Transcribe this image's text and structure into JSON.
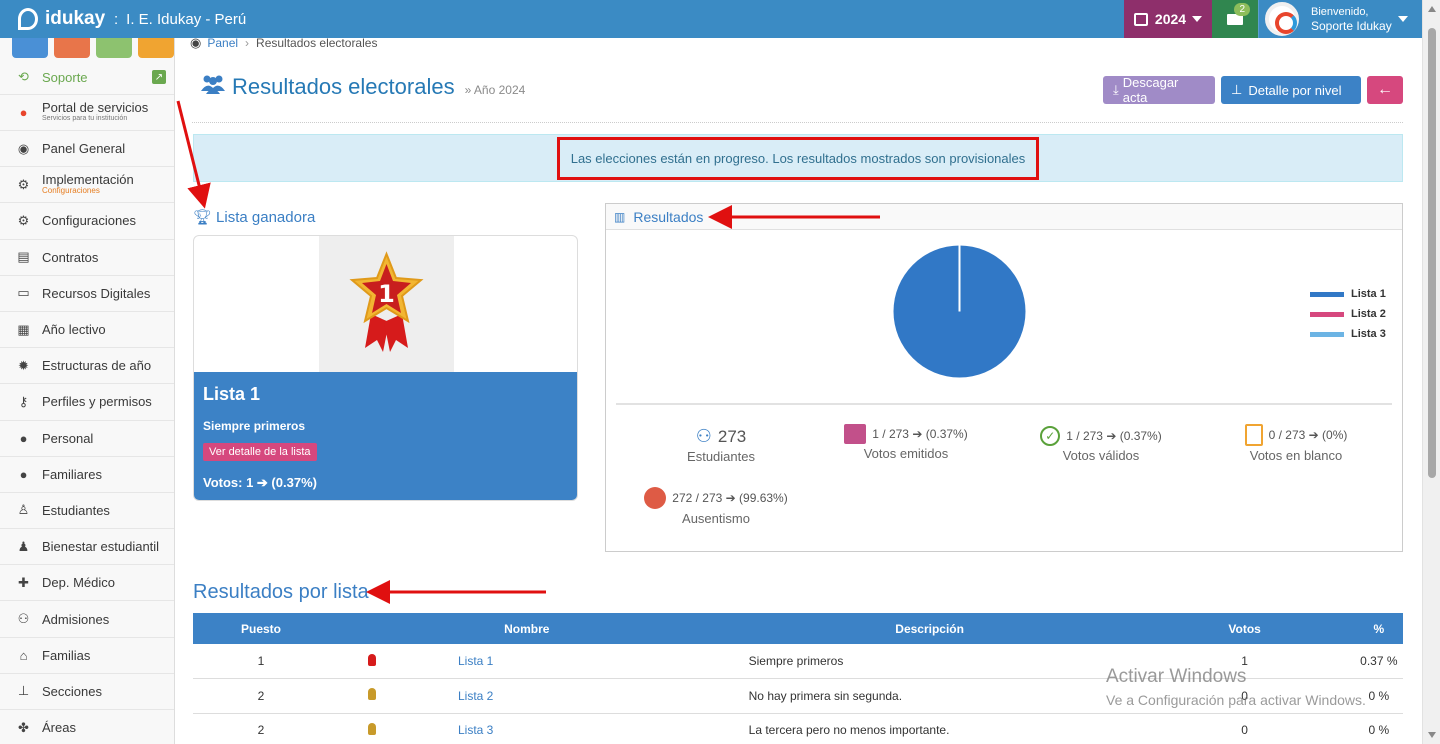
{
  "app": {
    "logo_text": "idukay",
    "institution": "I. E. Idukay - Perú",
    "year": "2024",
    "mail_badge": "2",
    "welcome": "Bienvenido,",
    "user_name": "Soporte Idukay"
  },
  "sidebar": {
    "soporte": "Soporte",
    "portal": {
      "label": "Portal de servicios",
      "sub": "Servicios para tu institución"
    },
    "items": [
      {
        "label": "Panel General",
        "icon": "dashboard-icon"
      },
      {
        "label": "Implementación",
        "sub": "Configuraciones",
        "icon": "gears-icon"
      },
      {
        "label": "Configuraciones",
        "icon": "gears-icon"
      },
      {
        "label": "Contratos",
        "icon": "document-icon"
      },
      {
        "label": "Recursos Digitales",
        "icon": "laptop-icon"
      },
      {
        "label": "Año lectivo",
        "icon": "calendar-icon"
      },
      {
        "label": "Estructuras de año",
        "icon": "gear-icon"
      },
      {
        "label": "Perfiles y permisos",
        "icon": "key-icon"
      },
      {
        "label": "Personal",
        "icon": "user-icon"
      },
      {
        "label": "Familiares",
        "icon": "user-icon"
      },
      {
        "label": "Estudiantes",
        "icon": "student-icon"
      },
      {
        "label": "Bienestar estudiantil",
        "icon": "wellbeing-icon"
      },
      {
        "label": "Dep. Médico",
        "icon": "medkit-icon"
      },
      {
        "label": "Admisiones",
        "icon": "users-icon"
      },
      {
        "label": "Familias",
        "icon": "home-icon"
      },
      {
        "label": "Secciones",
        "icon": "sitemap-icon"
      },
      {
        "label": "Áreas",
        "icon": "puzzle-icon"
      }
    ]
  },
  "breadcrumb": {
    "panel": "Panel",
    "current": "Resultados electorales"
  },
  "header": {
    "title": "Resultados electorales",
    "subtitle": "» Año 2024",
    "download_label": "Descagar acta",
    "detail_label": "Detalle por nivel"
  },
  "alert": "Las elecciones están en progreso. Los resultados mostrados son provisionales",
  "winner": {
    "section_title": "Lista ganadora",
    "name": "Lista 1",
    "motto": "Siempre primeros",
    "detail_button": "Ver detalle de la lista",
    "votes": "Votos: 1 ➔ (0.37%)"
  },
  "results": {
    "title": "Resultados",
    "students_count": "273",
    "students_label": "Estudiantes",
    "emitted": "1 / 273 ➔ (0.37%)",
    "emitted_label": "Votos emitidos",
    "valid": "1 / 273 ➔ (0.37%)",
    "valid_label": "Votos válidos",
    "blank": "0 / 273 ➔ (0%)",
    "blank_label": "Votos en blanco",
    "absent": "272 / 273 ➔ (99.63%)",
    "absent_label": "Ausentismo"
  },
  "chart_data": {
    "type": "pie",
    "categories": [
      "Lista 1",
      "Lista 2",
      "Lista 3"
    ],
    "values": [
      1,
      0,
      0
    ],
    "colors": [
      "#3178c6",
      "#d6487e",
      "#6cb4e4"
    ],
    "legend": "right"
  },
  "table": {
    "title": "Resultados por lista",
    "headers": [
      "Puesto",
      "Nombre",
      "Descripción",
      "Votos",
      "%"
    ],
    "rows": [
      {
        "rank": "1",
        "name": "Lista 1",
        "description": "Siempre primeros",
        "votes": "1",
        "pct": "0.37 %"
      },
      {
        "rank": "2",
        "name": "Lista 2",
        "description": "No hay primera sin segunda.",
        "votes": "0",
        "pct": "0 %"
      },
      {
        "rank": "2",
        "name": "Lista 3",
        "description": "La tercera pero no menos importante.",
        "votes": "0",
        "pct": "0 %"
      }
    ]
  },
  "watermark": {
    "line1": "Activar Windows",
    "line2": "Ve a Configuración para activar Windows."
  }
}
